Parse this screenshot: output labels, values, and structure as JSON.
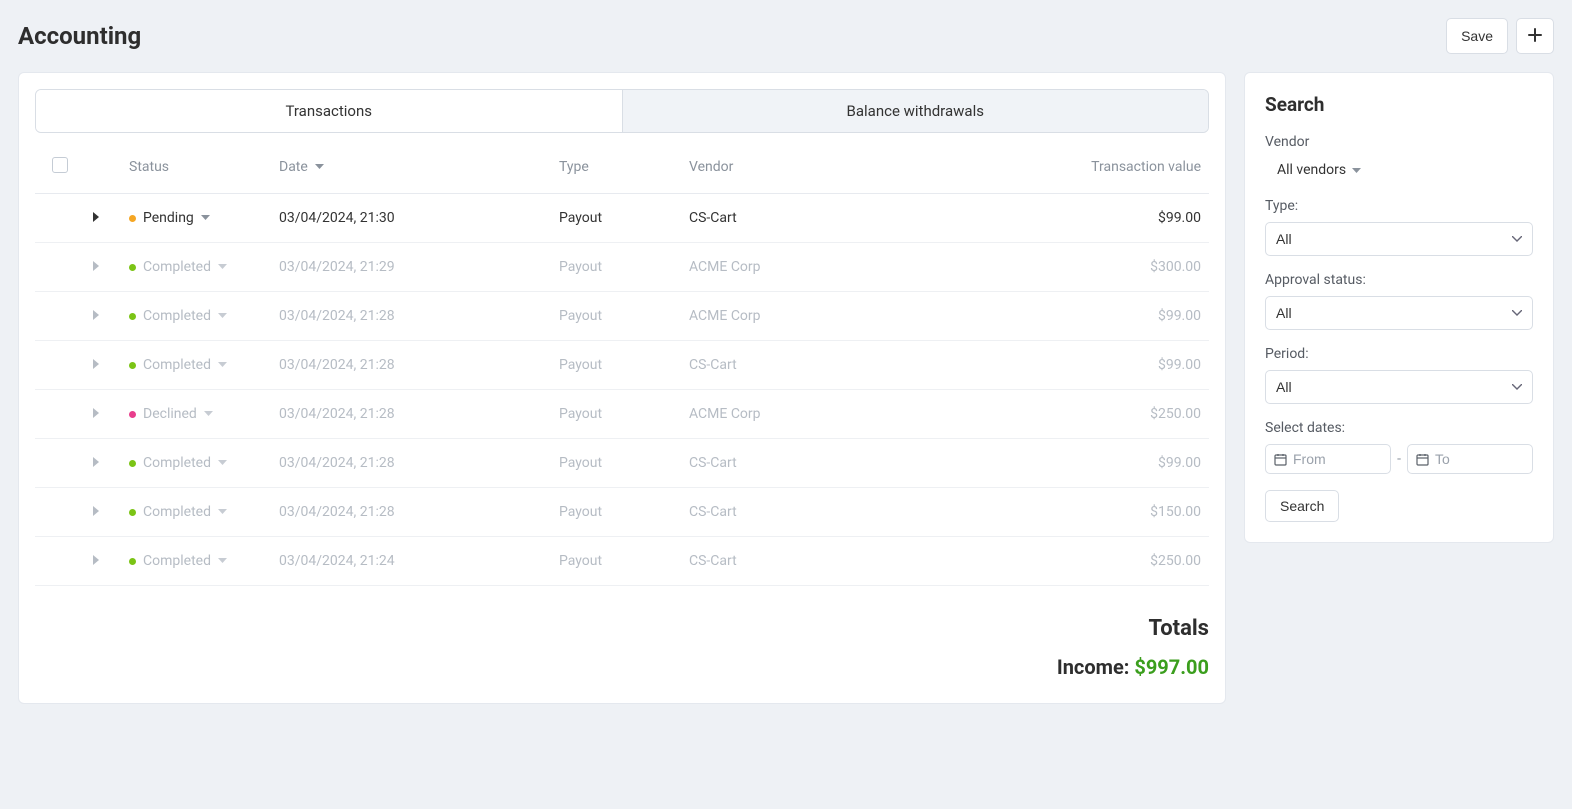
{
  "header": {
    "title": "Accounting",
    "save_label": "Save"
  },
  "tabs": {
    "transactions": "Transactions",
    "balance": "Balance withdrawals"
  },
  "columns": {
    "status": "Status",
    "date": "Date",
    "type": "Type",
    "vendor": "Vendor",
    "value": "Transaction value"
  },
  "transactions": [
    {
      "status_key": "pending",
      "status_label": "Pending",
      "date": "03/04/2024, 21:30",
      "type": "Payout",
      "vendor": "CS-Cart",
      "value": "$99.00",
      "muted": false
    },
    {
      "status_key": "completed",
      "status_label": "Completed",
      "date": "03/04/2024, 21:29",
      "type": "Payout",
      "vendor": "ACME Corp",
      "value": "$300.00",
      "muted": true
    },
    {
      "status_key": "completed",
      "status_label": "Completed",
      "date": "03/04/2024, 21:28",
      "type": "Payout",
      "vendor": "ACME Corp",
      "value": "$99.00",
      "muted": true
    },
    {
      "status_key": "completed",
      "status_label": "Completed",
      "date": "03/04/2024, 21:28",
      "type": "Payout",
      "vendor": "CS-Cart",
      "value": "$99.00",
      "muted": true
    },
    {
      "status_key": "declined",
      "status_label": "Declined",
      "date": "03/04/2024, 21:28",
      "type": "Payout",
      "vendor": "ACME Corp",
      "value": "$250.00",
      "muted": true
    },
    {
      "status_key": "completed",
      "status_label": "Completed",
      "date": "03/04/2024, 21:28",
      "type": "Payout",
      "vendor": "CS-Cart",
      "value": "$99.00",
      "muted": true
    },
    {
      "status_key": "completed",
      "status_label": "Completed",
      "date": "03/04/2024, 21:28",
      "type": "Payout",
      "vendor": "CS-Cart",
      "value": "$150.00",
      "muted": true
    },
    {
      "status_key": "completed",
      "status_label": "Completed",
      "date": "03/04/2024, 21:24",
      "type": "Payout",
      "vendor": "CS-Cart",
      "value": "$250.00",
      "muted": true
    }
  ],
  "totals": {
    "heading": "Totals",
    "income_label": "Income: ",
    "income_value": "$997.00"
  },
  "search": {
    "title": "Search",
    "vendor_label": "Vendor",
    "vendor_value": "All vendors",
    "type_label": "Type:",
    "type_value": "All",
    "approval_label": "Approval status:",
    "approval_value": "All",
    "period_label": "Period:",
    "period_value": "All",
    "dates_label": "Select dates:",
    "from_placeholder": "From",
    "to_placeholder": "To",
    "button": "Search"
  }
}
